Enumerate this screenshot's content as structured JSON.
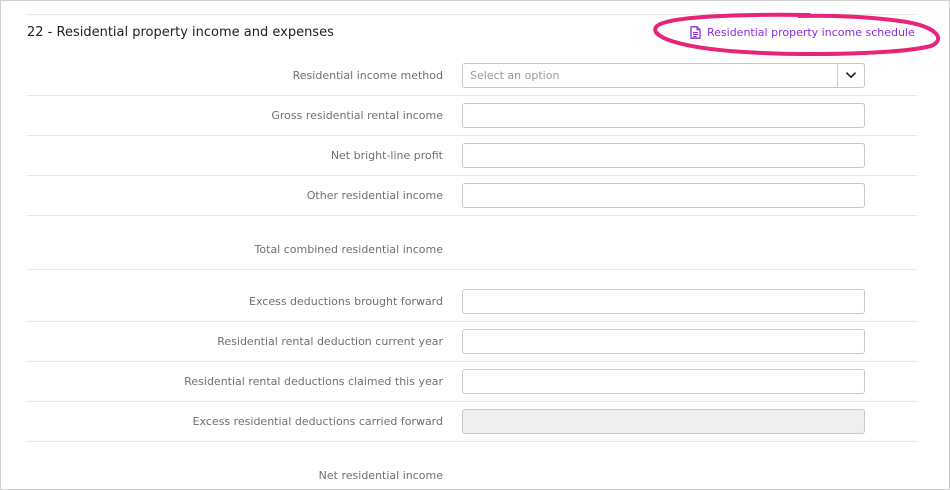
{
  "section": {
    "title": "22 - Residential property income and expenses",
    "schedule_link": "Residential property income schedule"
  },
  "fields": [
    {
      "label": "Residential income method",
      "type": "select",
      "placeholder": "Select an option"
    },
    {
      "label": "Gross residential rental income",
      "type": "input"
    },
    {
      "label": "Net bright-line profit",
      "type": "input"
    },
    {
      "label": "Other residential income",
      "type": "input"
    },
    {
      "label": "Total combined residential income",
      "type": "total"
    },
    {
      "label": "Excess deductions brought forward",
      "type": "input"
    },
    {
      "label": "Residential rental deduction current year",
      "type": "input"
    },
    {
      "label": "Residential rental deductions claimed this year",
      "type": "input"
    },
    {
      "label": "Excess residential deductions carried forward",
      "type": "readonly"
    },
    {
      "label": "Net residential income",
      "type": "total"
    }
  ],
  "icons": {
    "schedule": "document-icon",
    "dropdown": "chevron-down-icon"
  },
  "colors": {
    "link": "#8a2be2",
    "highlight": "#e8237a"
  }
}
